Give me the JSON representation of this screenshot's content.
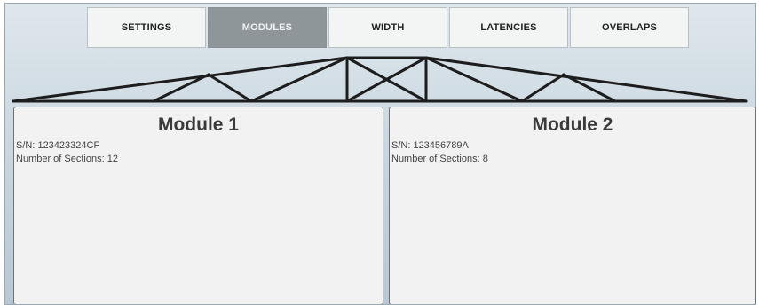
{
  "tabs": [
    {
      "label": "SETTINGS",
      "active": false
    },
    {
      "label": "MODULES",
      "active": true
    },
    {
      "label": "WIDTH",
      "active": false
    },
    {
      "label": "LATENCIES",
      "active": false
    },
    {
      "label": "OVERLAPS",
      "active": false
    }
  ],
  "modules": [
    {
      "title": "Module 1",
      "serial": "S/N: 123423324CF",
      "sections": "Number of Sections: 12"
    },
    {
      "title": "Module 2",
      "serial": "S/N: 123456789A",
      "sections": "Number of Sections: 8"
    }
  ],
  "colors": {
    "active_tab": "#8f969a",
    "tab_bg": "#f3f4f4",
    "header_bg": "#c6d4de",
    "panel_bg": "#f1f2f1",
    "truss": "#1d1d1d"
  },
  "icons": {
    "header_graphic": "boom-truss-diagram"
  }
}
